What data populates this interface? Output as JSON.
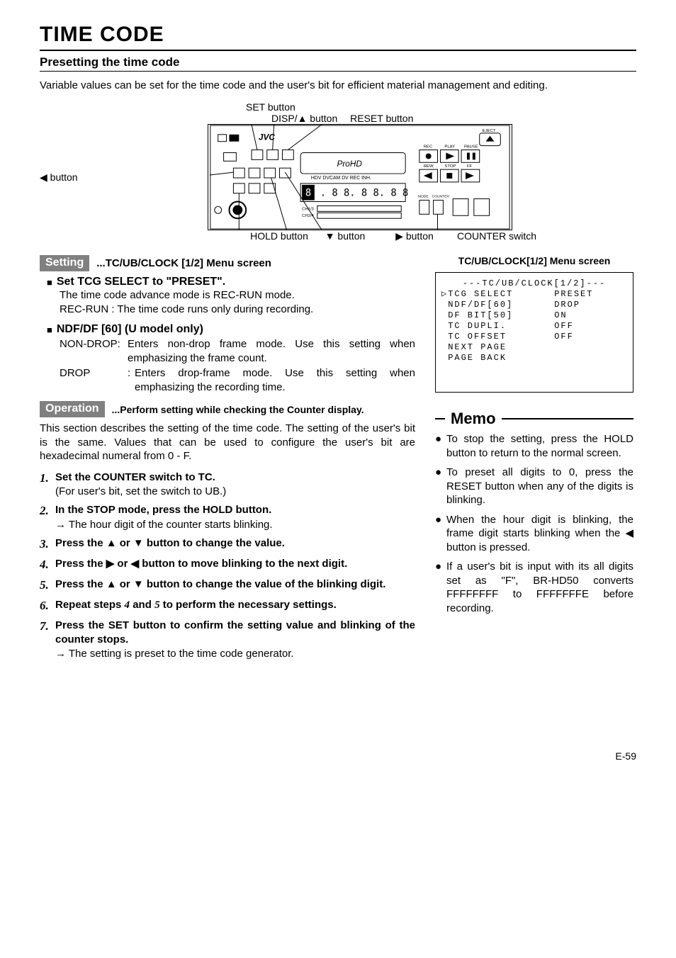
{
  "page": {
    "title": "TIME CODE",
    "subheading": "Presetting the time code",
    "intro": "Variable values can be set for the time code and the user's bit for efficient material management and editing.",
    "number": "E-59"
  },
  "diagram": {
    "labels": {
      "set_button": "SET button",
      "disp_up_button": "DISP/▲ button",
      "reset_button": "RESET button",
      "left_button": "◀ button",
      "hold_button": "HOLD button",
      "down_button": "▼ button",
      "right_button": "▶ button",
      "counter_switch": "COUNTER switch"
    }
  },
  "setting": {
    "tag": "Setting",
    "tag_text": "...TC/UB/CLOCK [1/2] Menu screen",
    "s1": {
      "head": "Set TCG SELECT to \"PRESET\".",
      "line1": "The time code advance mode is REC-RUN mode.",
      "line2_term": "REC-RUN :",
      "line2_desc": "The time code runs only during recording."
    },
    "s2": {
      "head": "NDF/DF [60] (U model only)",
      "r1_term": "NON-DROP:",
      "r1_desc": "Enters non-drop frame mode. Use this setting when emphasizing the frame count.",
      "r2_term": "DROP",
      "r2_sep": ":",
      "r2_desc": "Enters drop-frame mode. Use this setting when emphasizing the recording time."
    }
  },
  "operation": {
    "tag": "Operation",
    "tag_text": "...Perform setting while checking the Counter display.",
    "intro": "This section describes the setting of the time code. The setting of the user's bit is the same. Values that can be used to configure the user's bit are hexadecimal numeral from 0 - F.",
    "steps": [
      {
        "n": "1.",
        "lead": "Set the COUNTER switch to TC.",
        "sub": "(For user's bit, set the switch to UB.)"
      },
      {
        "n": "2.",
        "lead": "In the STOP mode, press the HOLD button.",
        "sub": "→ The hour digit of the counter starts blinking."
      },
      {
        "n": "3.",
        "lead": "Press the ▲ or ▼ button to change the value."
      },
      {
        "n": "4.",
        "lead": "Press the ▶ or ◀ button to move blinking to the next digit."
      },
      {
        "n": "5.",
        "lead": "Press the ▲ or ▼ button to change the value of the blinking digit."
      },
      {
        "n": "6.",
        "lead_pre": "Repeat steps ",
        "it1": "4",
        "mid": " and ",
        "it2": "5",
        "lead_post": " to perform the necessary settings."
      },
      {
        "n": "7.",
        "lead": "Press the SET button to confirm the setting value and blinking of the counter stops.",
        "sub": "→ The setting is preset to the time code generator."
      }
    ]
  },
  "menu": {
    "caption": "TC/UB/CLOCK[1/2] Menu screen",
    "header": "---TC/UB/CLOCK[1/2]---",
    "rows": [
      {
        "cursor": "▷",
        "k": "TCG SELECT",
        "v": "PRESET"
      },
      {
        "cursor": " ",
        "k": "NDF/DF[60]",
        "v": "DROP"
      },
      {
        "cursor": " ",
        "k": "DF BIT[50]",
        "v": "ON"
      },
      {
        "cursor": " ",
        "k": "TC DUPLI.",
        "v": "OFF"
      },
      {
        "cursor": " ",
        "k": "TC OFFSET",
        "v": "OFF"
      },
      {
        "cursor": " ",
        "k": "NEXT PAGE",
        "v": ""
      },
      {
        "cursor": " ",
        "k": "PAGE BACK",
        "v": ""
      }
    ]
  },
  "memo": {
    "title": "Memo",
    "items": [
      "To stop the setting, press the HOLD button to return to the normal screen.",
      "To preset all digits to 0, press the RESET button when any of the digits is blinking.",
      "When the hour digit is blinking, the frame digit starts blinking when the ◀ button is pressed.",
      "If a user's bit is input with its all digits set as \"F\", BR-HD50 converts FFFFFFFF to FFFFFFFE before recording."
    ]
  }
}
